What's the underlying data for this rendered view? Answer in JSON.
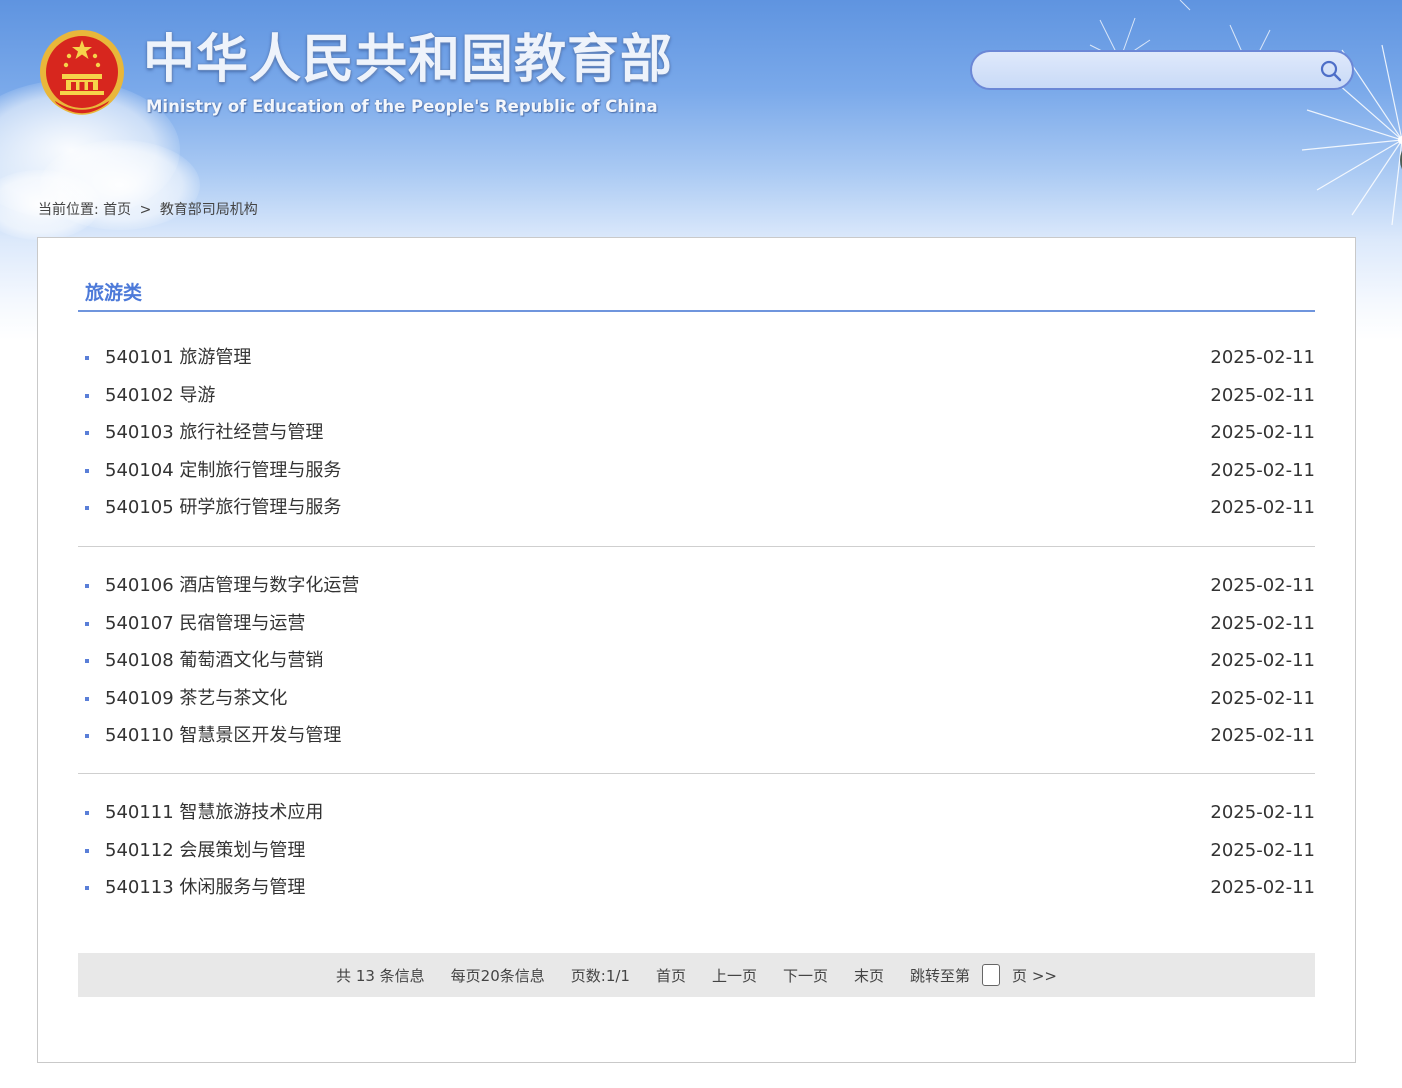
{
  "header": {
    "title": "中华人民共和国教育部",
    "subtitle": "Ministry of Education of the People's Republic of China",
    "emblem_icon": "national-emblem-icon"
  },
  "search": {
    "placeholder": "",
    "button_icon": "search-icon"
  },
  "breadcrumb": {
    "prefix": "当前位置:",
    "home": "首页",
    "separator": ">",
    "current": "教育部司局机构"
  },
  "section": {
    "title": "旅游类",
    "groups": [
      [
        {
          "title": "540101 旅游管理",
          "date": "2025-02-11"
        },
        {
          "title": "540102 导游",
          "date": "2025-02-11"
        },
        {
          "title": "540103 旅行社经营与管理",
          "date": "2025-02-11"
        },
        {
          "title": "540104 定制旅行管理与服务",
          "date": "2025-02-11"
        },
        {
          "title": "540105 研学旅行管理与服务",
          "date": "2025-02-11"
        }
      ],
      [
        {
          "title": "540106 酒店管理与数字化运营",
          "date": "2025-02-11"
        },
        {
          "title": "540107 民宿管理与运营",
          "date": "2025-02-11"
        },
        {
          "title": "540108 葡萄酒文化与营销",
          "date": "2025-02-11"
        },
        {
          "title": "540109 茶艺与茶文化",
          "date": "2025-02-11"
        },
        {
          "title": "540110 智慧景区开发与管理",
          "date": "2025-02-11"
        }
      ],
      [
        {
          "title": "540111 智慧旅游技术应用",
          "date": "2025-02-11"
        },
        {
          "title": "540112 会展策划与管理",
          "date": "2025-02-11"
        },
        {
          "title": "540113 休闲服务与管理",
          "date": "2025-02-11"
        }
      ]
    ]
  },
  "pager": {
    "total": "共 13 条信息",
    "per_page": "每页20条信息",
    "page_count": "页数:1/1",
    "first": "首页",
    "prev": "上一页",
    "next": "下一页",
    "last": "末页",
    "jump_label": "跳转至第",
    "jump_value": "",
    "go": "页 >>"
  },
  "colors": {
    "accent": "#4d7ad9",
    "rule": "#6f95dd",
    "bullet": "#5a7fd8",
    "pager_bg": "#e8e8e8"
  }
}
